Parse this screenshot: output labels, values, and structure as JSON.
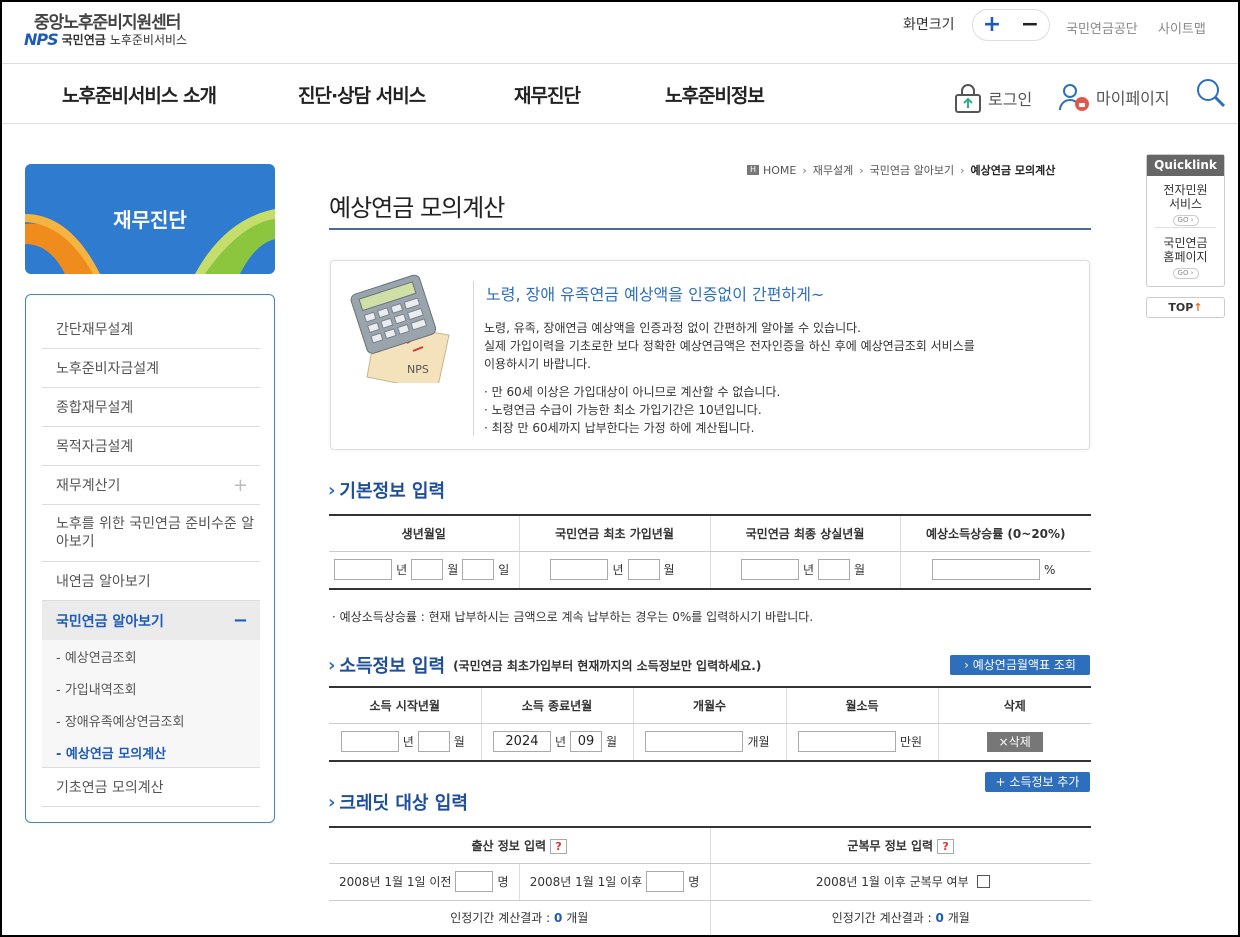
{
  "header": {
    "logo_title": "중앙노후준비지원센터",
    "logo_nps": "NPS",
    "logo_subtitle_1": "국민연금",
    "logo_subtitle_2": "노후준비서비스",
    "screen_size_label": "화면크기",
    "zoom_in": "+",
    "zoom_out": "−",
    "util_links": [
      "국민연금공단",
      "사이트맵"
    ]
  },
  "nav": {
    "items": [
      "노후준비서비스 소개",
      "진단·상담 서비스",
      "재무진단",
      "노후준비정보"
    ],
    "login": "로그인",
    "mypage": "마이페이지"
  },
  "sidebar": {
    "banner_title": "재무진단",
    "items": [
      {
        "label": "간단재무설계"
      },
      {
        "label": "노후준비자금설계"
      },
      {
        "label": "종합재무설계"
      },
      {
        "label": "목적자금설계"
      },
      {
        "label": "재무계산기",
        "expand": "+"
      },
      {
        "label": "노후를 위한 국민연금 준비수준 알아보기"
      },
      {
        "label": "내연금 알아보기"
      },
      {
        "label": "국민연금 알아보기",
        "expand": "−"
      },
      {
        "label": "기초연금 모의계산"
      }
    ],
    "sub_items": [
      "- 예상연금조회",
      "- 가입내역조회",
      "- 장애유족예상연금조회",
      "- 예상연금 모의계산"
    ]
  },
  "breadcrumb": {
    "home": "HOME",
    "items": [
      "재무설계",
      "국민연금 알아보기"
    ],
    "current": "예상연금 모의계산",
    "sep": "›"
  },
  "page_title": "예상연금 모의계산",
  "info": {
    "headline": "노령, 장애 유족연금 예상액을 인증없이 간편하게~",
    "para_1": "노령, 유족, 장애연금 예상액을 인증과정 없이 간편하게 알아볼 수 있습니다.",
    "para_2": "실제 가입이력을 기초로한 보다 정확한 예상연금액은 전자인증을 하신 후에 예상연금조회 서비스를",
    "para_3": "이용하시기 바랍니다.",
    "bullets": [
      "· 만 60세 이상은 가입대상이 아니므로 계산할 수 없습니다.",
      "· 노령연금 수급이 가능한 최소 가입기간은 10년입니다.",
      "· 최장 만 60세까지 납부한다는 가정 하에 계산됩니다."
    ],
    "image_label": "NPS"
  },
  "basic": {
    "title": "기본정보 입력",
    "headers": [
      "생년월일",
      "국민연금 최초 가입년월",
      "국민연금 최종 상실년월",
      "예상소득상승률 (0~20%)"
    ],
    "units": {
      "year": "년",
      "month": "월",
      "day": "일",
      "percent": "%"
    },
    "note": "· 예상소득상승률 : 현재 납부하시는 금액으로 계속 납부하는 경우는 0%를 입력하시기 바랍니다."
  },
  "income": {
    "title": "소득정보 입력",
    "note": "(국민연금 최초가입부터 현재까지의 소득정보만 입력하세요.)",
    "lookup_button": "› 예상연금월액표 조회",
    "headers": [
      "소득 시작년월",
      "소득 종료년월",
      "개월수",
      "월소득",
      "삭제"
    ],
    "end_year": "2024",
    "end_month": "09",
    "units": {
      "year": "년",
      "month": "월",
      "months": "개월",
      "won": "만원"
    },
    "delete_button": "×삭제",
    "add_button": "+ 소득정보 추가"
  },
  "credit": {
    "title": "크레딧 대상 입력",
    "birth_header": "출산 정보 입력",
    "military_header": "군복무 정보 입력",
    "help": "?",
    "before_label": "2008년 1월 1일 이전",
    "after_label": "2008년 1월 1일 이후",
    "people_unit": "명",
    "military_label": "2008년 1월 이후 군복무 여부",
    "result_label": "인정기간 계산결과 :",
    "birth_result": "0",
    "military_result": "0",
    "result_unit": "개월"
  },
  "quicklink": {
    "title": "Quicklink",
    "items": [
      {
        "line1": "전자민원",
        "line2": "서비스",
        "go": "GO ›"
      },
      {
        "line1": "국민연금",
        "line2": "홈페이지",
        "go": "GO ›"
      }
    ],
    "top": "TOP",
    "top_arrow": "↑"
  },
  "colors": {
    "brand_blue": "#2e6fbd",
    "title_blue": "#1f4f99",
    "nps_orange": "#e8a20a"
  }
}
